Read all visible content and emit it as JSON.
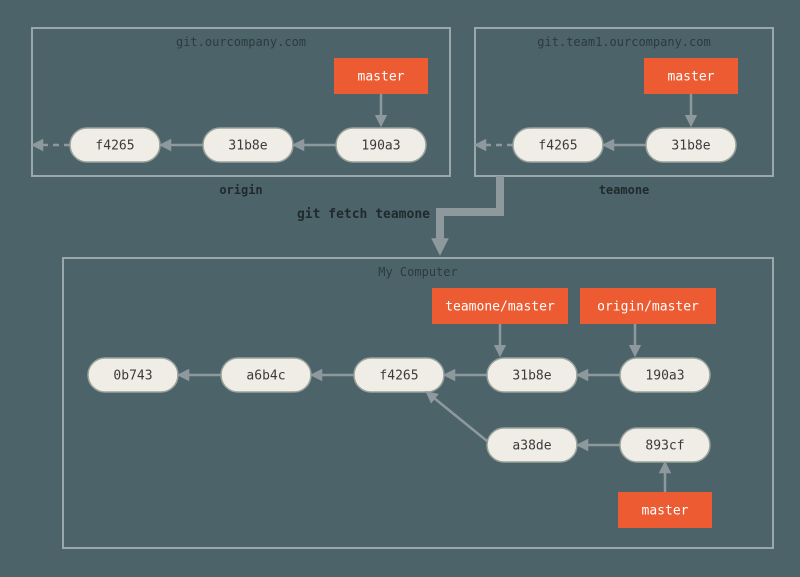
{
  "colors": {
    "background": "#4c6369",
    "panel_stroke": "#9aa8ab",
    "commit_fill": "#efede6",
    "commit_stroke": "#9aa39b",
    "tag_fill": "#ec5b32",
    "tag_text": "#ffffff",
    "arrow": "#8d999c"
  },
  "command": "git fetch teamone",
  "origin": {
    "title": "git.ourcompany.com",
    "footer": "origin",
    "commits": [
      "f4265",
      "31b8e",
      "190a3"
    ],
    "refs": {
      "master": "master"
    }
  },
  "teamone": {
    "title": "git.team1.ourcompany.com",
    "footer": "teamone",
    "commits": [
      "f4265",
      "31b8e"
    ],
    "refs": {
      "master": "master"
    }
  },
  "local": {
    "title": "My Computer",
    "commits_main": [
      "0b743",
      "a6b4c",
      "f4265",
      "31b8e",
      "190a3"
    ],
    "commits_branch": [
      "a38de",
      "893cf"
    ],
    "refs": {
      "teamone_master": "teamone/master",
      "origin_master": "origin/master",
      "master": "master"
    }
  }
}
